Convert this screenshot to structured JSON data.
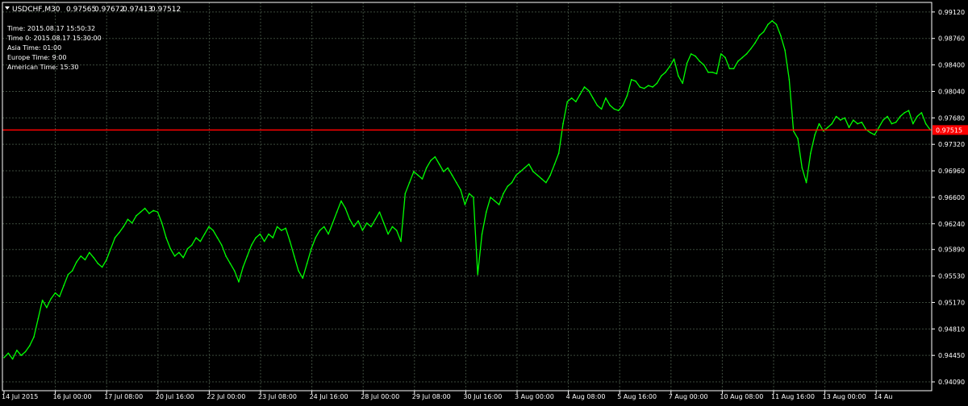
{
  "chart_data": {
    "type": "line",
    "header": {
      "symbol_timeframe": "USDCHF,M30",
      "ohlc": [
        "0.97565",
        "0.97672",
        "0.97413",
        "0.97512"
      ]
    },
    "info_lines": [
      "Time: 2015.08.17 15:50:32",
      "Time 0: 2015.08.17 15:30:00",
      "Asia Time: 01:00",
      "Europe Time: 9:00",
      "American Time: 15:30"
    ],
    "y_axis": {
      "ticks": [
        "0.99120",
        "0.98760",
        "0.98400",
        "0.98040",
        "0.97680",
        "0.97320",
        "0.96960",
        "0.96600",
        "0.96240",
        "0.95890",
        "0.95530",
        "0.95170",
        "0.94810",
        "0.94450",
        "0.94090"
      ],
      "ylim": [
        0.9397,
        0.9925
      ]
    },
    "x_axis": {
      "ticks": [
        "14 Jul 2015",
        "16 Jul 00:00",
        "17 Jul 08:00",
        "20 Jul 16:00",
        "22 Jul 00:00",
        "23 Jul 08:00",
        "24 Jul 16:00",
        "28 Jul 00:00",
        "29 Jul 08:00",
        "30 Jul 16:00",
        "3 Aug 00:00",
        "4 Aug 08:00",
        "5 Aug 16:00",
        "7 Aug 00:00",
        "10 Aug 08:00",
        "11 Aug 16:00",
        "13 Aug 00:00",
        "14 Au"
      ]
    },
    "current_price": "0.97515",
    "price_level": 0.97515,
    "colors": {
      "background": "#000000",
      "grid": "#3c4a3c",
      "price_line": "#00ff00",
      "level_line": "#ff0000",
      "level_label_bg": "#ff0000",
      "axis_text": "#ffffff"
    },
    "series": [
      {
        "values": [
          0.9442,
          0.9448,
          0.944,
          0.9452,
          0.9445,
          0.945,
          0.9458,
          0.947,
          0.9495,
          0.952,
          0.951,
          0.9522,
          0.953,
          0.9525,
          0.954,
          0.9555,
          0.956,
          0.9572,
          0.958,
          0.9575,
          0.9585,
          0.9578,
          0.957,
          0.9565,
          0.9575,
          0.959,
          0.9605,
          0.9612,
          0.962,
          0.963,
          0.9625,
          0.9635,
          0.964,
          0.9645,
          0.9638,
          0.9642,
          0.964,
          0.9625,
          0.9605,
          0.959,
          0.958,
          0.9585,
          0.9578,
          0.959,
          0.9595,
          0.9605,
          0.96,
          0.961,
          0.962,
          0.9615,
          0.9605,
          0.9595,
          0.958,
          0.957,
          0.956,
          0.9545,
          0.9565,
          0.958,
          0.9595,
          0.9605,
          0.961,
          0.96,
          0.961,
          0.9605,
          0.962,
          0.9615,
          0.9618,
          0.96,
          0.958,
          0.956,
          0.955,
          0.957,
          0.959,
          0.9605,
          0.9615,
          0.962,
          0.961,
          0.9625,
          0.964,
          0.9655,
          0.9645,
          0.963,
          0.962,
          0.9628,
          0.9615,
          0.9625,
          0.962,
          0.963,
          0.964,
          0.9625,
          0.961,
          0.962,
          0.9615,
          0.96,
          0.9665,
          0.968,
          0.9695,
          0.969,
          0.9685,
          0.97,
          0.971,
          0.9715,
          0.9705,
          0.9695,
          0.97,
          0.969,
          0.968,
          0.967,
          0.965,
          0.9665,
          0.966,
          0.9555,
          0.961,
          0.964,
          0.966,
          0.9655,
          0.965,
          0.9665,
          0.9675,
          0.968,
          0.969,
          0.9695,
          0.97,
          0.9705,
          0.9695,
          0.969,
          0.9685,
          0.968,
          0.969,
          0.9705,
          0.972,
          0.976,
          0.979,
          0.9795,
          0.979,
          0.98,
          0.981,
          0.9805,
          0.9795,
          0.9785,
          0.978,
          0.9795,
          0.9785,
          0.978,
          0.9778,
          0.9785,
          0.9798,
          0.982,
          0.9818,
          0.981,
          0.9808,
          0.9812,
          0.981,
          0.9815,
          0.9825,
          0.983,
          0.9838,
          0.9848,
          0.9825,
          0.9815,
          0.9842,
          0.9855,
          0.9852,
          0.9845,
          0.984,
          0.983,
          0.983,
          0.9828,
          0.9855,
          0.985,
          0.9835,
          0.9835,
          0.9845,
          0.985,
          0.9855,
          0.9862,
          0.987,
          0.988,
          0.9885,
          0.9895,
          0.99,
          0.9895,
          0.988,
          0.986,
          0.982,
          0.975,
          0.974,
          0.97,
          0.968,
          0.972,
          0.9745,
          0.976,
          0.975,
          0.9755,
          0.976,
          0.977,
          0.9765,
          0.9768,
          0.9755,
          0.9765,
          0.976,
          0.9762,
          0.9752,
          0.9748,
          0.9745,
          0.9755,
          0.9765,
          0.977,
          0.976,
          0.9762,
          0.977,
          0.9775,
          0.9778,
          0.976,
          0.977,
          0.9775,
          0.976,
          0.9752
        ]
      }
    ]
  }
}
